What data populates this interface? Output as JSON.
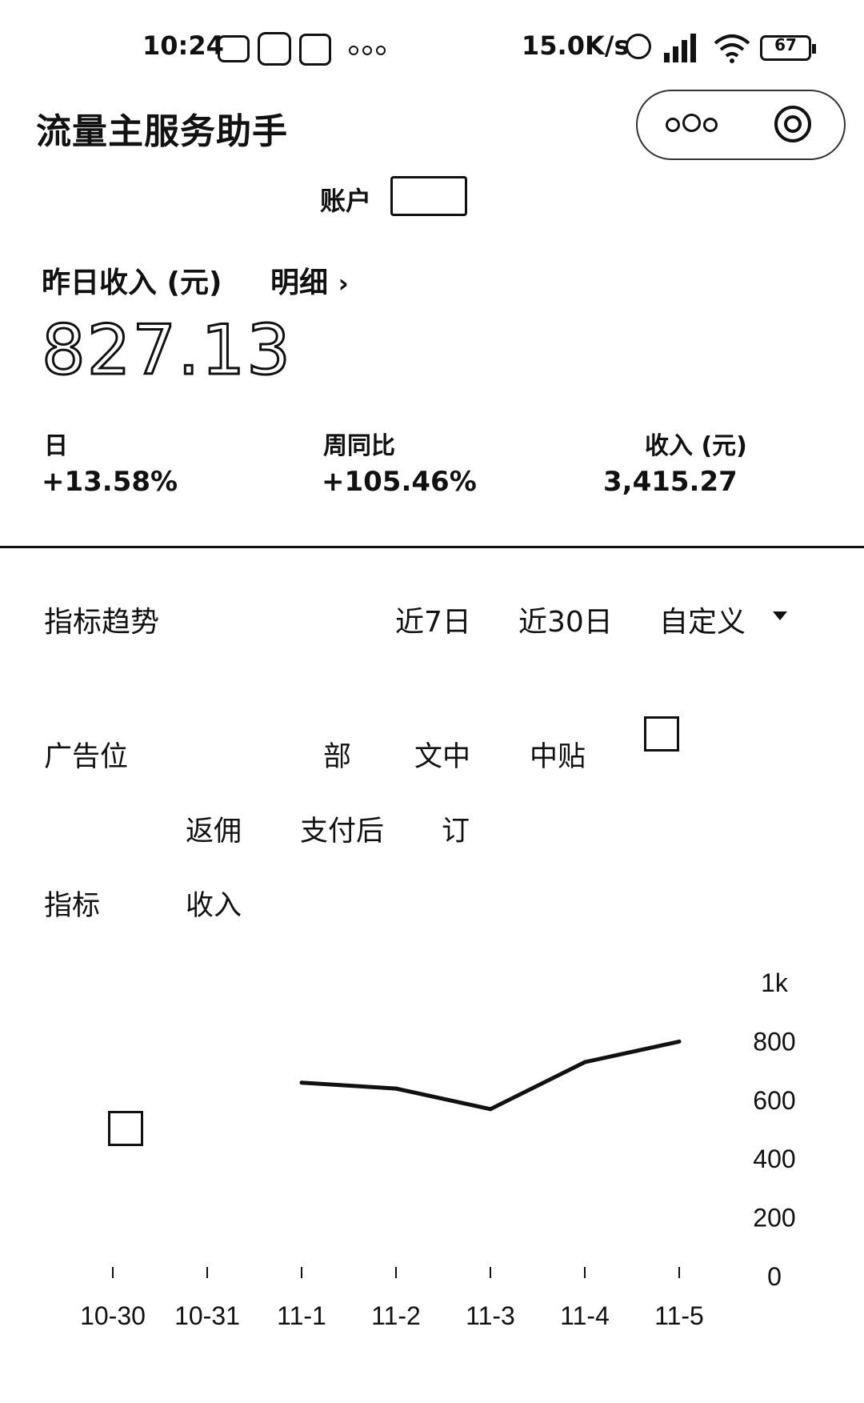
{
  "status_bar": {
    "time": "10:24",
    "net_speed": "15.0K/s",
    "battery": "67",
    "more": "···"
  },
  "header": {
    "title": "流量主服务助手",
    "menu_icon": "more-dots-icon",
    "close_icon": "target-close-icon"
  },
  "account": {
    "label": "账户"
  },
  "summary": {
    "yesterday_label": "昨日收入 (元)",
    "detail_link": "明细",
    "yesterday_value": "827.13",
    "stats": [
      {
        "label": "日",
        "value": "+13.58%"
      },
      {
        "label": "周同比",
        "value": "+105.46%"
      },
      {
        "label": "收入 (元)",
        "value": "3,415.27"
      }
    ]
  },
  "trend": {
    "title": "指标趋势",
    "ranges": [
      "近7日",
      "近30日",
      "自定义"
    ]
  },
  "filters": {
    "row1_label": "广告位",
    "row1": [
      "部",
      "文中",
      "中贴"
    ],
    "row2": [
      "返佣",
      "支付后",
      "订"
    ],
    "metric_label": "指标",
    "metric_value": "收入"
  },
  "chart_data": {
    "type": "line",
    "categories": [
      "10-30",
      "10-31",
      "11-1",
      "11-2",
      "11-3",
      "11-4",
      "11-5"
    ],
    "yticks": [
      "0",
      "200",
      "400",
      "600",
      "800",
      "1k"
    ],
    "ylim": [
      0,
      1000
    ],
    "series": [
      {
        "values": [
          null,
          null,
          660,
          640,
          570,
          730,
          800
        ]
      }
    ]
  }
}
